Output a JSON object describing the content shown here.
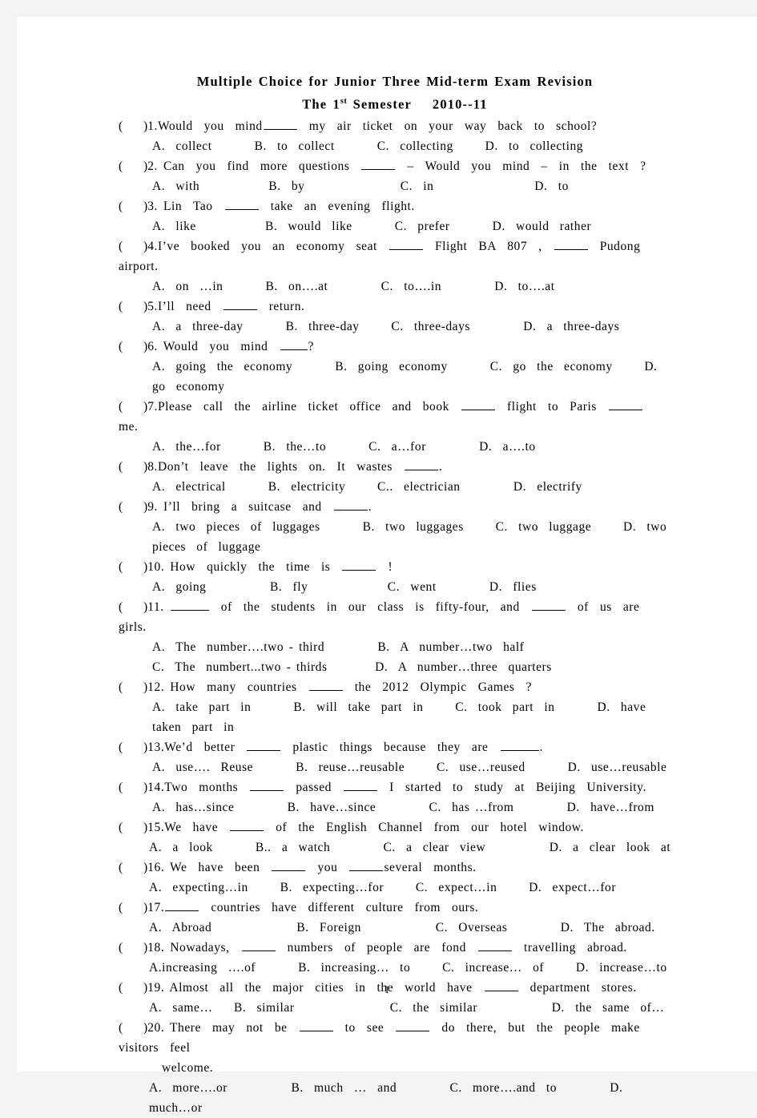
{
  "document": {
    "title_line1": "Multiple  Choice  for  Junior  Three  Mid-term  Exam  Revision",
    "title_line2_part1": "The  1",
    "title_line2_sup": "st",
    "title_line2_part2": "  Semester",
    "title_line2_part3": "2010--11",
    "page_number": "1"
  },
  "questions": [
    {
      "num": "1.",
      "stem_a": "Would  you  mind",
      "stem_b": "  my  air  ticket  on  your  way  back  to  school?",
      "options": "A.  collect        B.  to  collect        C.  collecting      D.  to  collecting"
    },
    {
      "num": "2.",
      "stem_a": " Can  you  find  more  questions  ",
      "stem_b": "  –  Would  you  mind  –  in  the  text  ?",
      "options": "A.  with             B.  by                  C.  in                   D.  to"
    },
    {
      "num": "3.",
      "stem_a": " Lin  Tao  ",
      "stem_b": "  take  an  evening  flight.",
      "options": "A.  like             B.  would  like        C.  prefer        D.  would  rather"
    },
    {
      "num": "4.",
      "stem_a": "I’ve  booked  you  an  economy  seat  ",
      "stem_b": "  Flight  BA  807  ,  ",
      "stem_c": "  Pudong  airport.",
      "options": "A.  on  …in        B.  on….at          C.  to….in          D.  to….at"
    },
    {
      "num": "5.",
      "stem_a": "I’ll  need  ",
      "stem_b": "  return.",
      "options": "A.  a  three-day        B.  three-day      C.  three-days          D.  a  three-days"
    },
    {
      "num": "6.",
      "stem_a": " Would  you  mind  ",
      "stem_b": "?",
      "options": "A.  going  the  economy        B.  going  economy        C.  go  the  economy      D.  go  economy"
    },
    {
      "num": "7.",
      "stem_a": "Please  call  the  airline  ticket  office  and  book  ",
      "stem_b": "  flight  to  Paris  ",
      "stem_c": "  me.",
      "options": "A.  the…for        B.  the…to        C.  a…for          D.  a….to"
    },
    {
      "num": "8.",
      "stem_a": "Don’t  leave  the  lights  on.  It  wastes  ",
      "stem_b": ".",
      "options": "A.  electrical        B.  electricity      C..  electrician          D.  electrify"
    },
    {
      "num": "9.",
      "stem_a": " I’ll  bring  a  suitcase  and  ",
      "stem_b": ".",
      "options": "A.  two  pieces  of  luggages        B.  two  luggages      C.  two  luggage      D.  two  pieces  of  luggage"
    },
    {
      "num": "10.",
      "stem_a": " How  quickly  the  time  is  ",
      "stem_b": "  !",
      "options": "A.  going            B.  fly               C.  went          D.  flies"
    },
    {
      "num": "11.",
      "stem_a": " ",
      "stem_b": "  of  the  students  in  our  class  is  fifty-four,  and  ",
      "stem_c": "  of  us  are  girls.",
      "options": "A.  The  number….two - third          B.  A  number…two  half",
      "options2": "C.  The  numbert...two - thirds         D.  A  number…three  quarters"
    },
    {
      "num": "12.",
      "stem_a": " How  many  countries  ",
      "stem_b": "  the  2012  Olympic  Games  ?",
      "options": "A.  take  part  in        B.  will  take  part  in      C.  took  part  in        D.  have  taken  part  in"
    },
    {
      "num": "13.",
      "stem_a": "We’d  better  ",
      "stem_b": "  plastic  things  because  they  are  ",
      "stem_c": ".",
      "options": "A.  use….  Reuse        B.  reuse…reusable      C.  use…reused        D.  use…reusable"
    },
    {
      "num": "14.",
      "stem_a": "Two  months  ",
      "stem_b": "  passed  ",
      "stem_c": "  I  started  to  study  at  Beijing  University.",
      "options": "A.  has…since          B.  have…since          C.  has …from          D.  have…from"
    },
    {
      "num": "15.",
      "stem_a": "We  have  ",
      "stem_b": "  of  the  English  Channel  from  our  hotel  window.",
      "options": "A.  a  look        B..  a  watch          C.  a  clear  view            D.  a  clear  look  at"
    },
    {
      "num": "16.",
      "stem_a": " We  have  been  ",
      "stem_b": "  you  ",
      "stem_c": "several  months.",
      "options": "A.  expecting…in      B.  expecting…for      C.  expect…in      D.  expect…for"
    },
    {
      "num": "17.",
      "stem_a": "",
      "stem_b": "  countries  have  different  culture  from  ours.",
      "options": "A.  Abroad                B.  Foreign              C.  Overseas          D.  The  abroad."
    },
    {
      "num": "18.",
      "stem_a": " Nowadays,  ",
      "stem_b": "  numbers  of  people  are  fond  ",
      "stem_c": "  travelling  abroad.",
      "options": "A.increasing  ….of        B.  increasing…  to      C.  increase…  of      D.  increase…to"
    },
    {
      "num": "19.",
      "stem_a": " Almost  all  the  major  cities  in  the  world  have  ",
      "stem_b": "  department  stores.",
      "options": "A.  same…    B.  similar                  C.  the  similar              D.  the  same  of…"
    },
    {
      "num": "20.",
      "stem_a": " There  may  not  be  ",
      "stem_b": "  to  see  ",
      "stem_c": "  do  there,  but  the  people  make  visitors  feel",
      "wrap": "welcome.",
      "options": "A.  more….or            B.  much  …  and          C.  more….and  to          D.  much…or"
    }
  ]
}
